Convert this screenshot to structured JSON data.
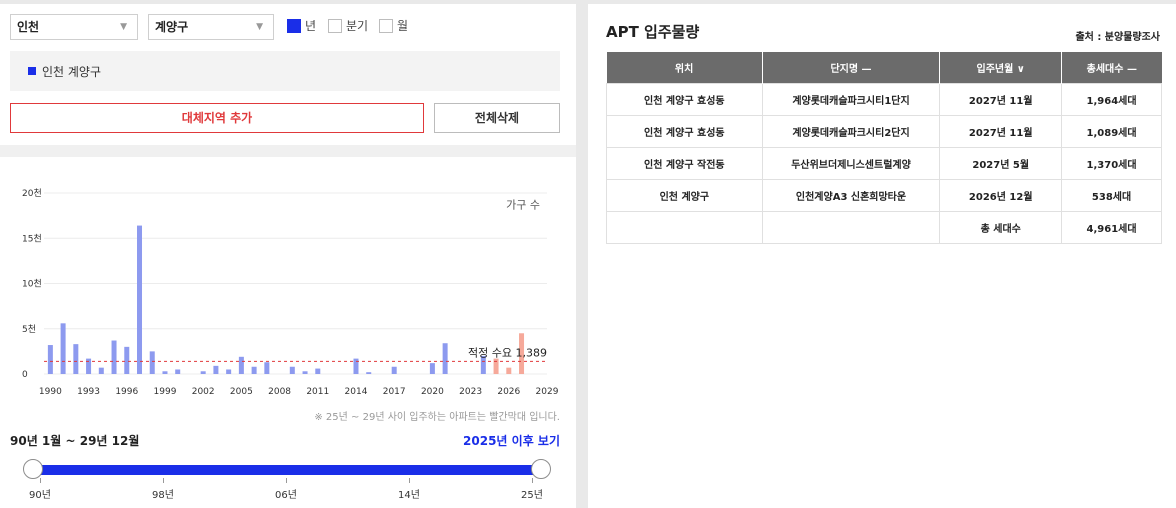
{
  "filters": {
    "region": "인천",
    "district": "계양구",
    "period_options": [
      {
        "label": "년",
        "checked": true
      },
      {
        "label": "분기",
        "checked": false
      },
      {
        "label": "월",
        "checked": false
      }
    ]
  },
  "selected_region": "인천 계양구",
  "buttons": {
    "add": "대체지역 추가",
    "clear": "전체삭제"
  },
  "chart_data": {
    "type": "bar",
    "legend": "가구 수",
    "y_ticks": [
      "20천",
      "15천",
      "10천",
      "5천",
      "0"
    ],
    "y_max": 20000,
    "x_ticks": [
      "1990",
      "1993",
      "1996",
      "1999",
      "2002",
      "2005",
      "2008",
      "2011",
      "2014",
      "2017",
      "2020",
      "2023",
      "2026",
      "2029"
    ],
    "x_range": [
      1989.5,
      2029
    ],
    "years": [
      1990,
      1991,
      1992,
      1993,
      1994,
      1995,
      1996,
      1997,
      1998,
      1999,
      2000,
      2001,
      2002,
      2003,
      2004,
      2005,
      2006,
      2007,
      2008,
      2009,
      2010,
      2011,
      2012,
      2013,
      2014,
      2015,
      2016,
      2017,
      2018,
      2019,
      2020,
      2021,
      2022,
      2023,
      2024,
      2025,
      2026,
      2027
    ],
    "values": [
      3200,
      5600,
      3300,
      1700,
      700,
      3700,
      3000,
      16400,
      2500,
      300,
      500,
      0,
      300,
      900,
      500,
      1900,
      800,
      1300,
      0,
      800,
      300,
      600,
      0,
      0,
      1700,
      200,
      0,
      800,
      0,
      0,
      1200,
      3400,
      0,
      0,
      2000,
      1700,
      700,
      4500
    ],
    "highlight_from": 2025,
    "reference": {
      "value": 1389,
      "label": "적정 수요 1,389"
    },
    "colors": {
      "normal": "#8d9aef",
      "highlight": "#f6a99a",
      "reference": "#e0393b"
    }
  },
  "note": "※ 25년 ~ 29년 사이 입주하는 아파트는 빨간막대 입니다.",
  "range_label": "90년 1월 ~ 29년 12월",
  "after_link": "2025년 이후 보기",
  "slider": {
    "labels": [
      "90년",
      "98년",
      "06년",
      "14년",
      "25년"
    ]
  },
  "right_panel": {
    "title": "APT 입주물량",
    "source": "출처 : 분양물량조사",
    "columns": [
      "위치",
      "단지명 —",
      "입주년월 ∨",
      "총세대수 —"
    ],
    "rows": [
      [
        "인천 계양구 효성동",
        "계양롯데캐슬파크시티1단지",
        "2027년 11월",
        "1,964세대"
      ],
      [
        "인천 계양구 효성동",
        "계양롯데캐슬파크시티2단지",
        "2027년 11월",
        "1,089세대"
      ],
      [
        "인천 계양구 작전동",
        "두산위브더제니스센트럴계양",
        "2027년 5월",
        "1,370세대"
      ],
      [
        "인천 계양구",
        "인천계양A3 신혼희망타운",
        "2026년 12월",
        "538세대"
      ]
    ],
    "total_label": "총 세대수",
    "total_value": "4,961세대"
  }
}
